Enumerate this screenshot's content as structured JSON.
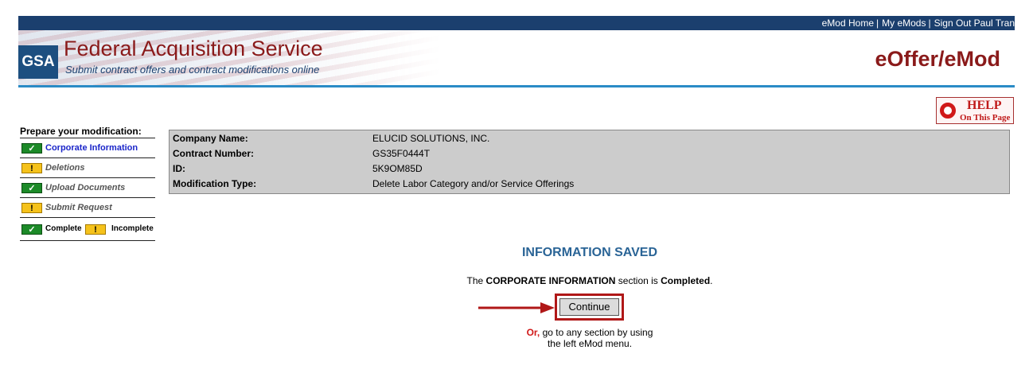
{
  "topnav": {
    "links": [
      "eMod Home",
      "My eMods",
      "Sign Out Paul Tran"
    ],
    "separator": "|"
  },
  "header": {
    "logo_text": "GSA",
    "title": "Federal Acquisition Service",
    "subtitle": "Submit contract offers and contract modifications online",
    "brand": "eOffer/eMod"
  },
  "help": {
    "line1": "HELP",
    "line2": "On This Page",
    "icon": "life-ring-icon"
  },
  "menu": {
    "heading": "Prepare your modification:",
    "items": [
      {
        "label": "Corporate Information",
        "status": "complete",
        "icon": "checkmark-icon"
      },
      {
        "label": "Deletions",
        "status": "incomplete",
        "icon": "exclamation-icon"
      },
      {
        "label": "Upload Documents",
        "status": "complete",
        "icon": "checkmark-icon"
      },
      {
        "label": "Submit Request",
        "status": "incomplete",
        "icon": "exclamation-icon"
      }
    ],
    "legend": {
      "complete": "Complete",
      "incomplete": "Incomplete"
    }
  },
  "info": {
    "rows": [
      {
        "label": "Company Name:",
        "value": "ELUCID SOLUTIONS, INC."
      },
      {
        "label": "Contract Number:",
        "value": "GS35F0444T"
      },
      {
        "label": "ID:",
        "value": "5K9OM85D"
      },
      {
        "label": "Modification Type:",
        "value": "Delete Labor Category and/or Service Offerings"
      }
    ]
  },
  "message": {
    "heading": "INFORMATION SAVED",
    "line_prefix": "The",
    "line_section": "CORPORATE INFORMATION",
    "line_middle": "section is",
    "line_status": "Completed",
    "line_end": ".",
    "continue_label": "Continue",
    "or_word": "Or,",
    "or_rest_1": "go to any section by using",
    "or_rest_2": "the left eMod menu."
  },
  "colors": {
    "topbar": "#1b3f6e",
    "brand_red": "#8a1a1a",
    "accent_blue": "#2a8bc6",
    "complete_green": "#1c8a28",
    "incomplete_yellow": "#f5c21b",
    "highlight_red": "#b01818"
  }
}
